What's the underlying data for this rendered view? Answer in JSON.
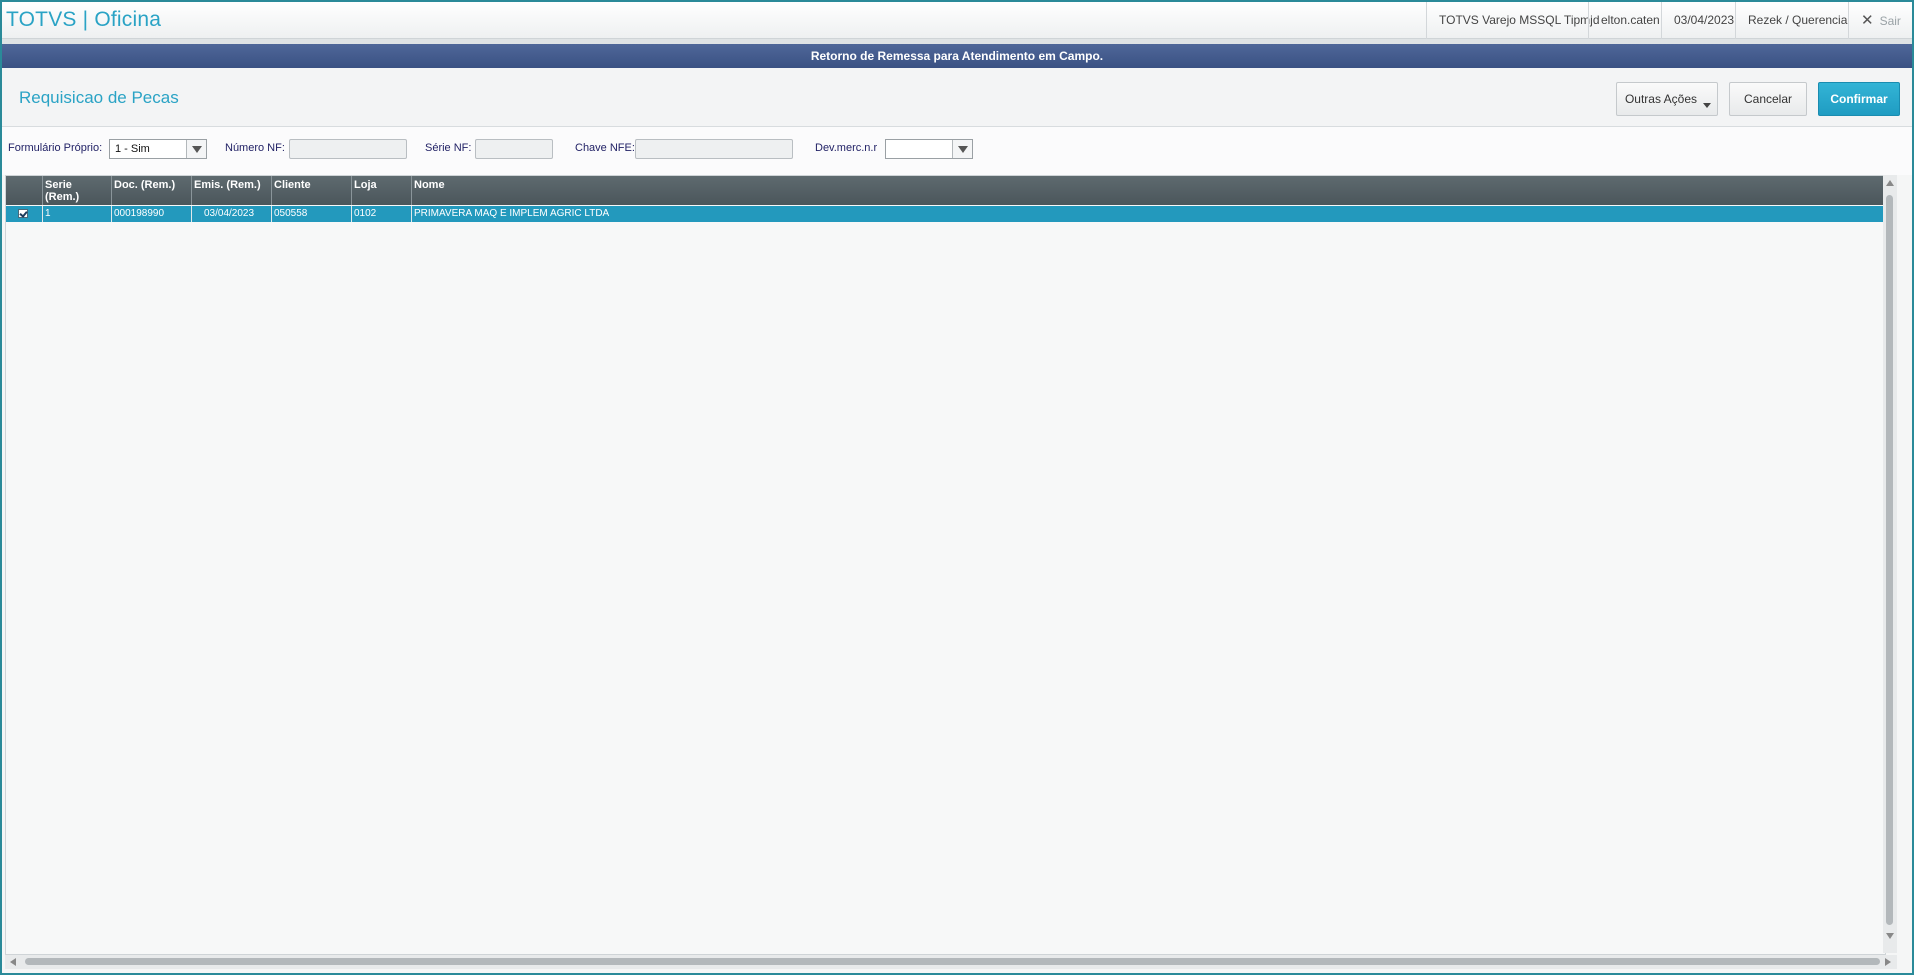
{
  "app": {
    "title": "TOTVS | Oficina"
  },
  "topbar": {
    "environment": "TOTVS Varejo MSSQL Tipmjd",
    "user": "elton.caten",
    "date": "03/04/2023",
    "branch": "Rezek / Querencia",
    "exit_label": "Sair"
  },
  "dialog": {
    "title": "Retorno de Remessa para Atendimento em Campo."
  },
  "page": {
    "title": "Requisicao de Pecas"
  },
  "buttons": {
    "other_actions": "Outras Ações",
    "cancel": "Cancelar",
    "confirm": "Confirmar"
  },
  "filters": {
    "formulario_label": "Formulário Próprio:",
    "formulario_value": "1 - Sim",
    "numero_nf_label": "Número NF:",
    "numero_nf_value": "",
    "serie_nf_label": "Série NF:",
    "serie_nf_value": "",
    "chave_nfe_label": "Chave NFE:",
    "chave_nfe_value": "",
    "dev_merc_label": "Dev.merc.n.r",
    "dev_merc_value": ""
  },
  "grid": {
    "columns": [
      "Serie (Rem.)",
      "Doc. (Rem.)",
      "Emis. (Rem.)",
      "Cliente",
      "Loja",
      "Nome"
    ],
    "rows": [
      {
        "checked": true,
        "serie": "1",
        "doc": "000198990",
        "emis": "03/04/2023",
        "cliente": "050558",
        "loja": "0102",
        "nome": "PRIMAVERA MAQ E IMPLEM AGRIC LTDA"
      }
    ]
  },
  "icons": {
    "exit": "close-icon",
    "dropdown": "chevron-down-icon",
    "row_check": "checkbox-checked-icon"
  },
  "colors": {
    "accent": "#2aa3c5",
    "dialog_band": "#43598b",
    "selected_row": "#2399bd",
    "confirm_button": "#24a3c9"
  }
}
